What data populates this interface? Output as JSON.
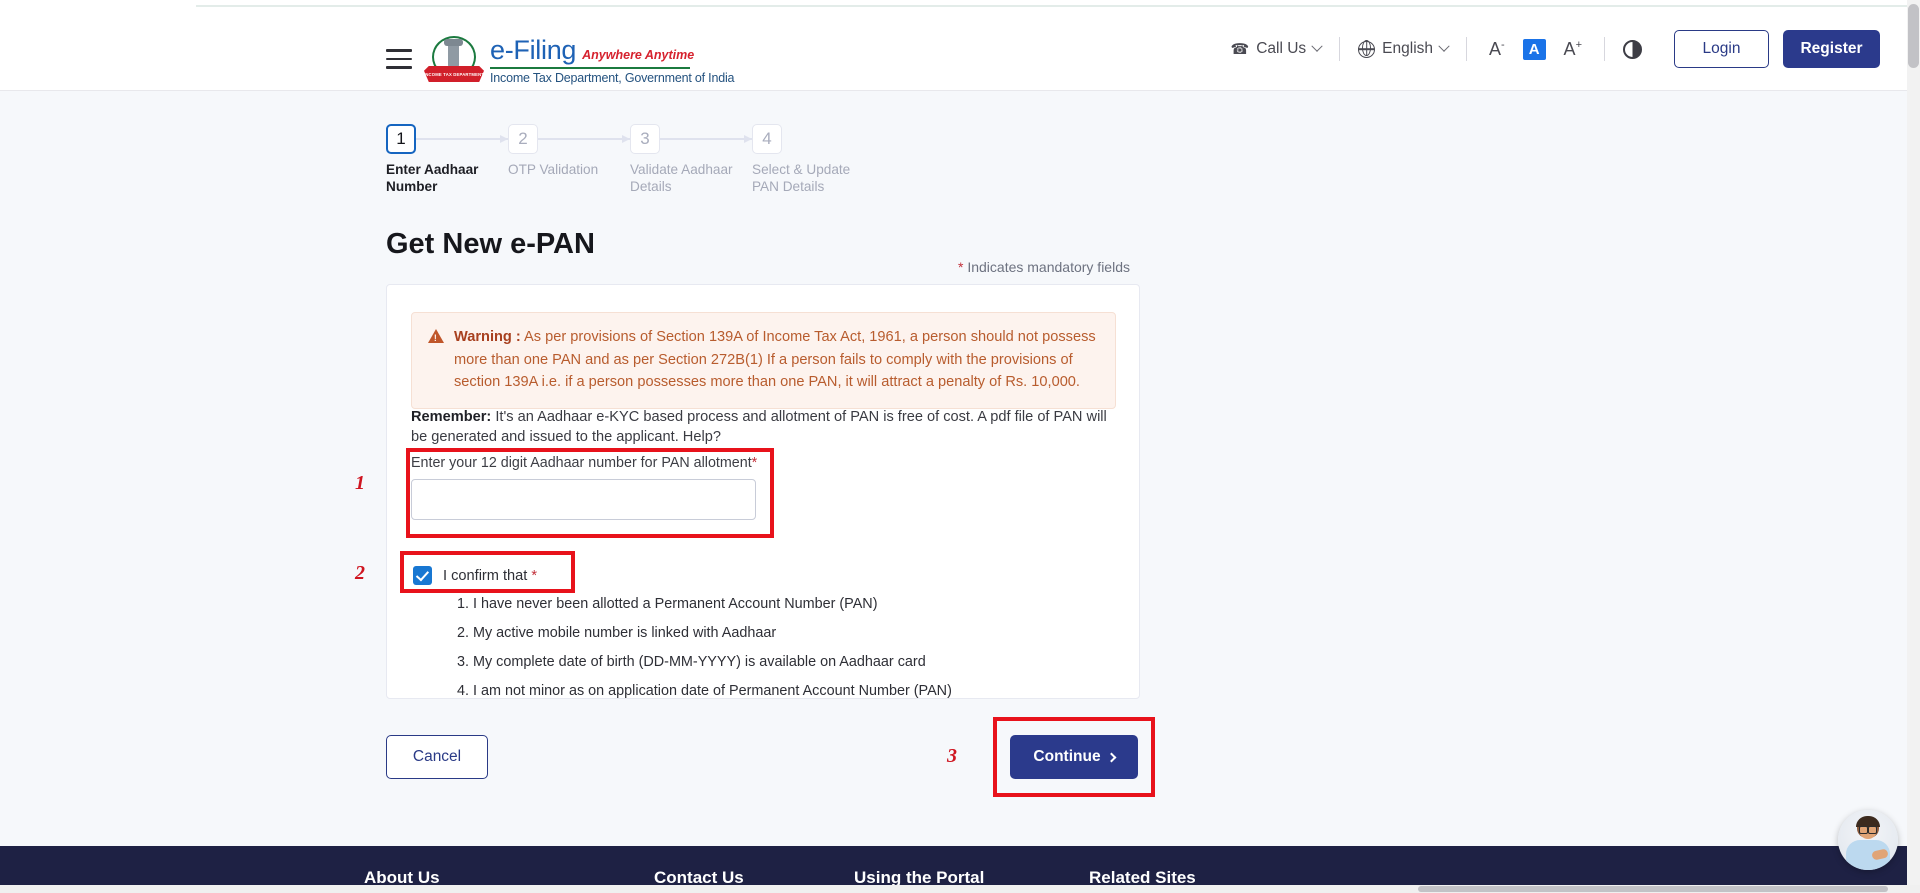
{
  "header": {
    "menu_icon": "hamburger-icon",
    "brand": {
      "title": "e-Filing",
      "tagline": "Anywhere Anytime",
      "department": "Income Tax Department, Government of India",
      "emblem_ribbon": "INCOME TAX DEPARTMENT"
    },
    "call_us": "Call Us",
    "language": "English",
    "font_decrease": "A",
    "font_decrease_sup": "-",
    "font_normal": "A",
    "font_increase": "A",
    "font_increase_sup": "+",
    "contrast_icon": "contrast-icon",
    "login": "Login",
    "register": "Register"
  },
  "stepper": {
    "steps": [
      {
        "number": "1",
        "label": "Enter Aadhaar Number",
        "state": "active"
      },
      {
        "number": "2",
        "label": "OTP Validation",
        "state": "idle"
      },
      {
        "number": "3",
        "label": "Validate Aadhaar Details",
        "state": "idle"
      },
      {
        "number": "4",
        "label": "Select & Update PAN Details",
        "state": "idle"
      }
    ]
  },
  "main": {
    "page_title": "Get New e-PAN",
    "mandatory_star": "*",
    "mandatory_note": " Indicates mandatory fields",
    "warning": {
      "label": "Warning :",
      "text": " As per provisions of Section 139A of Income Tax Act, 1961, a person should not possess more than one PAN and as per Section 272B(1) If a person fails to comply with the provisions of section 139A i.e. if a person possesses more than one PAN, it will attract a penalty of Rs. 10,000."
    },
    "remember": {
      "label": "Remember:",
      "text": " It's an Aadhaar e-KYC based process and allotment of PAN is free of cost. A pdf file of PAN will be generated and issued to the applicant. Help?"
    },
    "aadhaar_field": {
      "label": "Enter your 12 digit Aadhaar number for PAN allotment",
      "required_star": "*",
      "value": "",
      "placeholder": ""
    },
    "confirm": {
      "checked": true,
      "label": "I confirm that",
      "required_star": "*",
      "items": [
        "1. I have never been allotted a Permanent Account Number (PAN)",
        "2. My active mobile number is linked with Aadhaar",
        "3. My complete date of birth (DD-MM-YYYY) is available on Aadhaar card",
        "4. I am not minor as on application date of Permanent Account Number (PAN)"
      ]
    },
    "cancel_button": "Cancel",
    "continue_button": "Continue"
  },
  "annotations": {
    "one": "1",
    "two": "2",
    "three": "3",
    "color": "#e8121b"
  },
  "footer": {
    "columns": [
      "About Us",
      "Contact Us",
      "Using the Portal",
      "Related Sites"
    ]
  },
  "chat": {
    "name": "chat-assistant-avatar"
  },
  "colors": {
    "brand_blue": "#1e62b5",
    "brand_red": "#d6222e",
    "brand_green": "#1b7a3f",
    "primary_button": "#2b3a8c",
    "accent_checkbox": "#1877d2",
    "warning_text": "#b85c2e",
    "warning_bg": "#fdf3ee",
    "footer_bg": "#1e2144",
    "annotation_red": "#e8121b"
  }
}
